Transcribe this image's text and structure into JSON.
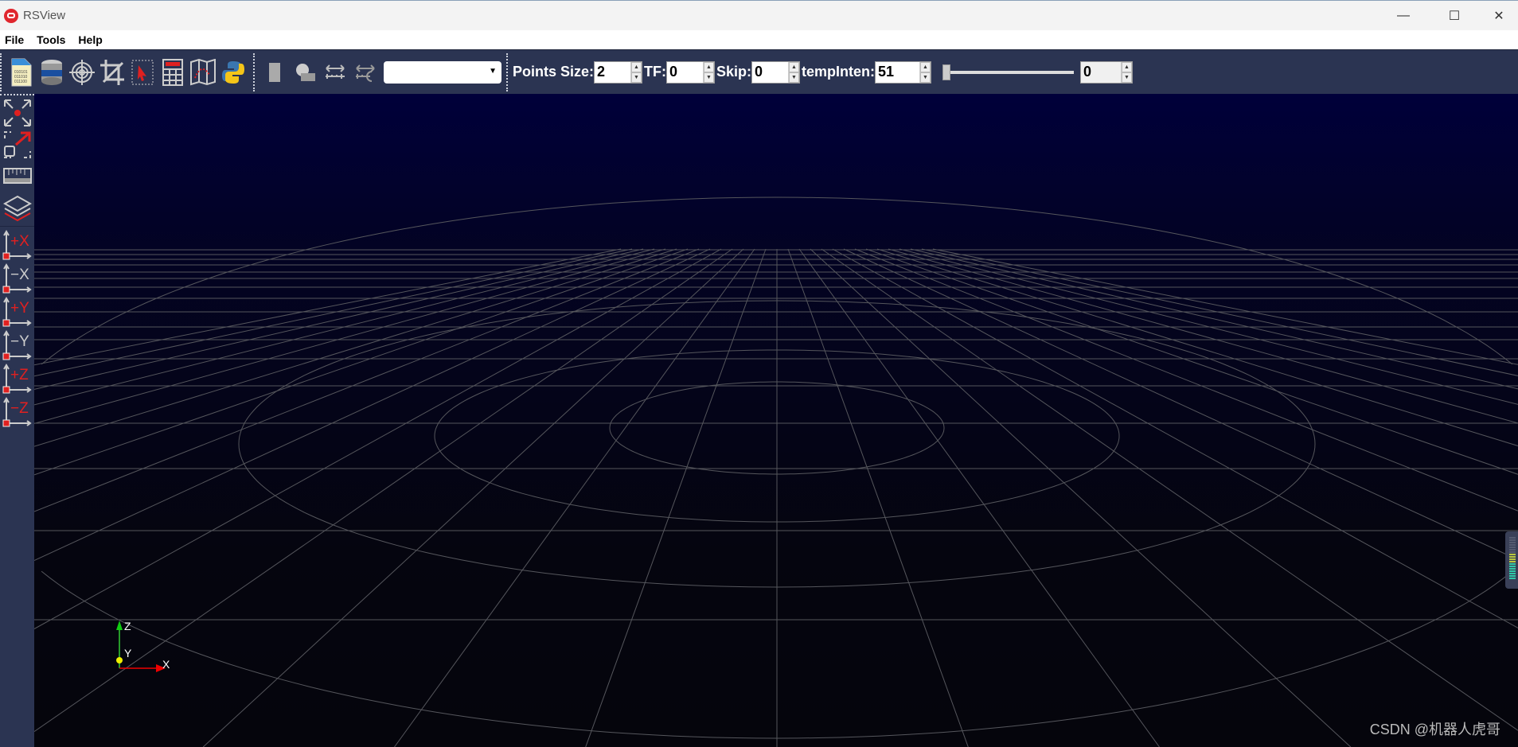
{
  "window": {
    "title": "RSView",
    "minimize": "—",
    "maximize": "☐",
    "close": "✕"
  },
  "menu": [
    "File",
    "Tools",
    "Help"
  ],
  "toolbar": {
    "points_size_label": "Points Size:",
    "points_size": "2",
    "tf_label": "TF:",
    "tf": "0",
    "skip_label": "Skip:",
    "skip": "0",
    "tempinten_label": "tempInten:",
    "tempinten": "51",
    "slider_value": 0,
    "slider_display": "0",
    "combo_value": ""
  },
  "sidebar": {
    "view_buttons": [
      "+X",
      "−X",
      "+Y",
      "−Y",
      "+Z",
      "−Z"
    ]
  },
  "axes": {
    "z": "Z",
    "y": "Y",
    "x": "X"
  },
  "watermark": "CSDN @机器人虎哥"
}
